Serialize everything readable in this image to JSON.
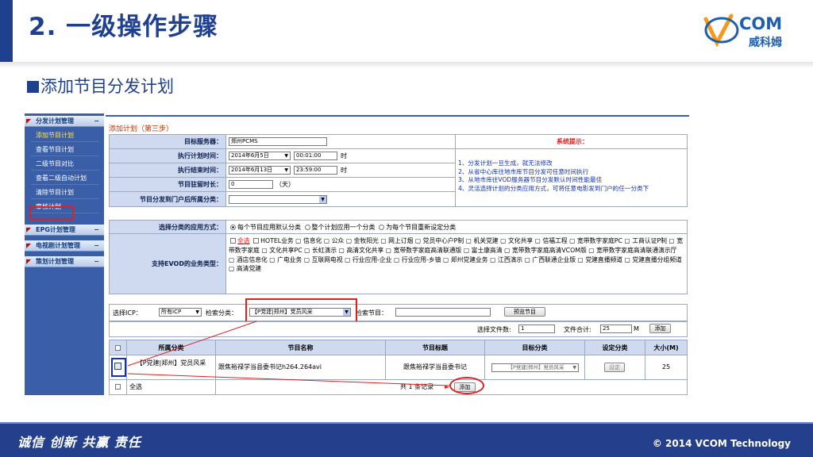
{
  "slide": {
    "title": "2. 一级操作步骤",
    "subtitle": "添加节目分发计划",
    "brand_top": "COM",
    "brand_cn": "威科姆",
    "slogan_1": "诚信",
    "slogan_2": "创新",
    "slogan_3": "共赢",
    "slogan_4": "责任",
    "copyright": "© 2014 VCOM Technology",
    "colors": {
      "primary": "#1f3f8f",
      "highlight": "#e02020"
    }
  },
  "sidebar": {
    "groups": [
      {
        "label": "分发计划管理"
      },
      {
        "label": "EPG计划管理"
      },
      {
        "label": "电视剧计划管理"
      },
      {
        "label": "策划计划管理"
      }
    ],
    "items": [
      {
        "label": "添加节目计划"
      },
      {
        "label": "查看节目计划"
      },
      {
        "label": "二级节目对比"
      },
      {
        "label": "查看二级自动计划"
      },
      {
        "label": "清除节目计划"
      },
      {
        "label": "审核计划"
      }
    ]
  },
  "form": {
    "heading": "添加计划（第三步）",
    "server_label": "目标服务器：",
    "server_value": "郑州PCMS",
    "exec_label": "执行计划时间：",
    "exec_date": "2014年6月5日",
    "exec_time": "00:01:00",
    "exec_unit": "时",
    "end_label": "执行结束时间：",
    "end_date": "2014年6月13日",
    "end_time": "23:59:00",
    "end_unit": "时",
    "stay_label": "节目驻留时长：",
    "stay_value": "0",
    "stay_unit": "（天）",
    "portal_label": "节目分发到门户后所属分类：",
    "apply_label": "选择分类的应用方式：",
    "apply_options": [
      "每个节目应用默认分类",
      "整个计划应用一个分类",
      "为每个节目重新设定分类"
    ],
    "evod_label": "支持EVOD的业务类型：",
    "evod_all": "全选",
    "evod_rest": "HOTEL业务 ▢ 信息化 ▢ 公众 ▢ 金牧阳光 ▢ 网上订烟 ▢ 党员中心户P制 ▢ 机关党建 ▢ 文化共享 ▢ 信福工程 ▢ 宽带数字家庭PC ▢ 工商认证P制 ▢ 宽带数字家庭 ▢ 文化共享PC ▢ 长虹演示 ▢ 高清文化共享 ▢ 宽带数字家庭高清联通版 ▢ 富士康高清 ▢ 宽带数字家庭高清VCOM版 ▢ 宽带数字家庭高清联通演示厅 ▢ 酒店信息化 ▢ 广电业务 ▢ 互联网电视 ▢ 行业应用-企业 ▢ 行业应用-乡镇 ▢ 郑州党建业务 ▢ 江西演示 ▢ 广西联通企业版 ▢ 党建直播频道 ▢ 党建直播分组频道 ▢ 高清党建",
    "tips_title": "系统提示：",
    "tips": [
      "1、分发计划一旦生成，就无法修改",
      "2、从省中心库往地市库节目分发可任意时间执行",
      "3、从地市库往VOD服务器节目分发默认时间性能最佳",
      "4、灵活选择计划的分类应用方式，可将任意电影发到门户的任一分类下"
    ]
  },
  "search": {
    "icp_label": "选择ICP：",
    "icp_value": "所有ICP",
    "cat_label": "检索分类：",
    "cat_value": "【P党建|郑州】党员风采",
    "prog_label": "检索节目：",
    "preview_btn": "预览节目",
    "file_count_label": "选择文件数:",
    "file_count": "1",
    "file_total_label": "文件合计:",
    "file_total": "25",
    "file_unit": "M",
    "add_btn": "添加"
  },
  "table": {
    "headers": [
      "所属分类",
      "节目名称",
      "节目标题",
      "目标分类",
      "设定分类",
      "大小(M)"
    ],
    "row": {
      "category": "【P党建|郑州】党员风采",
      "name": "跟焦裕禄学当县委书记h264.264avi",
      "title": "跟焦裕禄学当县委书记",
      "target": "【P党建|郑州】党员风采",
      "set_btn": "设定",
      "size": "25"
    },
    "select_all": "全选",
    "record_text": "共 1 条记录",
    "add_btn": "添加"
  }
}
